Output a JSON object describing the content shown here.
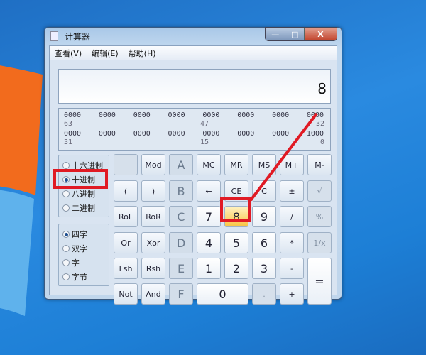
{
  "window": {
    "title": "计算器",
    "controls": {
      "minimize": "—",
      "maximize": "□",
      "close": "X"
    }
  },
  "menu": [
    "查看(V)",
    "编辑(E)",
    "帮助(H)"
  ],
  "display": {
    "value": "8"
  },
  "binary": {
    "row1": [
      "0000",
      "0000",
      "0000",
      "0000",
      "0000",
      "0000",
      "0000",
      "0000"
    ],
    "row1_labels": {
      "left": "63",
      "mid": "47",
      "right": "32"
    },
    "row2": [
      "0000",
      "0000",
      "0000",
      "0000",
      "0000",
      "0000",
      "0000",
      "1000"
    ],
    "row2_labels": {
      "left": "31",
      "mid": "15",
      "right": "0"
    }
  },
  "radix": {
    "options": [
      "十六进制",
      "十进制",
      "八进制",
      "二进制"
    ],
    "selected": "十进制"
  },
  "wordsize": {
    "options": [
      "四字",
      "双字",
      "字",
      "字节"
    ],
    "selected": "四字"
  },
  "buttons": {
    "r0": [
      "",
      "Mod",
      "A",
      "MC",
      "MR",
      "MS",
      "M+",
      "M-"
    ],
    "r1": [
      "(",
      ")",
      "B",
      "←",
      "CE",
      "C",
      "±",
      "√"
    ],
    "r2": [
      "RoL",
      "RoR",
      "C",
      "7",
      "8",
      "9",
      "/",
      "%"
    ],
    "r3": [
      "Or",
      "Xor",
      "D",
      "4",
      "5",
      "6",
      "*",
      "1/x"
    ],
    "r4": [
      "Lsh",
      "Rsh",
      "E",
      "1",
      "2",
      "3",
      "-",
      "="
    ],
    "r5": [
      "Not",
      "And",
      "F",
      "0",
      ".",
      "+"
    ]
  },
  "annotation_color": "#e01a24"
}
